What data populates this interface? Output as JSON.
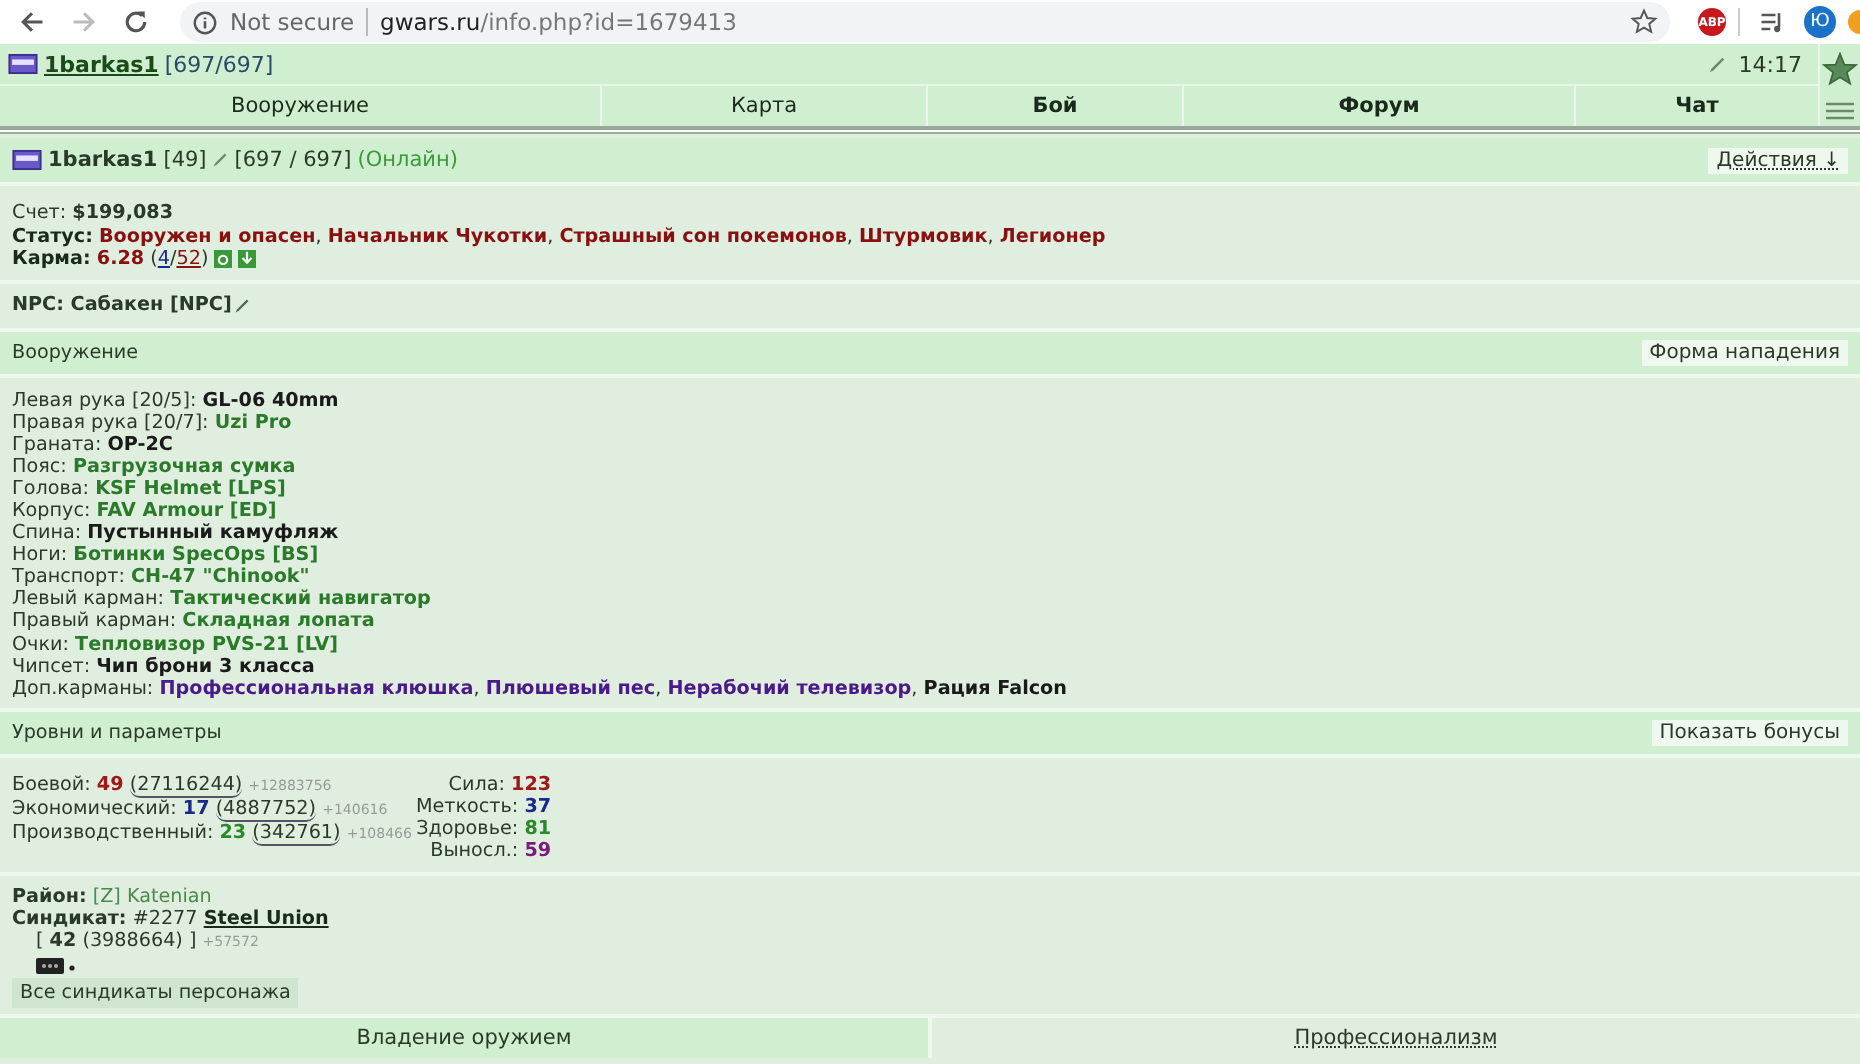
{
  "browser": {
    "security_label": "Not secure",
    "url_host": "gwars.ru",
    "url_path": "/info.php?id=1679413",
    "extension_badge": "ABP",
    "profile_initial": "Ю"
  },
  "header": {
    "nick": "1barkas1",
    "hp": "[697/697]",
    "time": "14:17"
  },
  "nav": [
    {
      "label": "Вооружение",
      "bold": false
    },
    {
      "label": "Карта",
      "bold": false
    },
    {
      "label": "Бой",
      "bold": true
    },
    {
      "label": "Форум",
      "bold": true
    },
    {
      "label": "Чат",
      "bold": true
    }
  ],
  "player": {
    "nick": "1barkas1",
    "level": "[49]",
    "hp": "[697 / 697]",
    "online": "(Онлайн)",
    "actions_button": "Действия ↓"
  },
  "account": {
    "label": "Счет:",
    "value": "$199,083"
  },
  "status": {
    "label": "Статус:",
    "separator": ", ",
    "items": [
      "Вооружен и опасен",
      "Начальник Чукотки",
      "Страшный сон покемонов",
      "Штурмовик",
      "Легионер"
    ]
  },
  "karma": {
    "label": "Карма:",
    "value": "6.28",
    "votes_open": "(",
    "votes_plus": "4",
    "votes_sep": "/",
    "votes_minus": "52",
    "votes_close": ")"
  },
  "npc": {
    "label": "NPC:",
    "value": "Сабакен [NPC]"
  },
  "equipment": {
    "title": "Вооружение",
    "button": "Форма нападения",
    "separator": ", ",
    "slots": [
      {
        "label": "Левая рука [20/5]:",
        "items": [
          {
            "name": "GL-06 40mm",
            "color": "#1a1a1a"
          }
        ]
      },
      {
        "label": "Правая рука [20/7]:",
        "items": [
          {
            "name": "Uzi Pro",
            "color": "#2a7a2a"
          }
        ]
      },
      {
        "label": "Граната:",
        "items": [
          {
            "name": "OP-2C",
            "color": "#1a1a1a"
          }
        ]
      },
      {
        "label": "Пояс:",
        "items": [
          {
            "name": "Разгрузочная сумка",
            "color": "#2a7a2a"
          }
        ]
      },
      {
        "label": "Голова:",
        "items": [
          {
            "name": "KSF Helmet [LPS]",
            "color": "#2a7a2a"
          }
        ]
      },
      {
        "label": "Корпус:",
        "items": [
          {
            "name": "FAV Armour [ED]",
            "color": "#2a7a2a"
          }
        ]
      },
      {
        "label": "Спина:",
        "items": [
          {
            "name": "Пустынный камуфляж",
            "color": "#1a1a1a"
          }
        ]
      },
      {
        "label": "Ноги:",
        "items": [
          {
            "name": "Ботинки SpecOps [BS]",
            "color": "#2a7a2a"
          }
        ]
      },
      {
        "label": "Транспорт:",
        "items": [
          {
            "name": "CH-47 \"Chinook\"",
            "color": "#2a7a2a"
          }
        ]
      },
      {
        "label": "Левый карман:",
        "items": [
          {
            "name": "Тактический навигатор",
            "color": "#2a7a2a"
          }
        ]
      },
      {
        "label": "Правый карман:",
        "items": [
          {
            "name": "Складная лопата",
            "color": "#2a7a2a"
          }
        ]
      },
      {
        "label": "Очки:",
        "items": [
          {
            "name": "Тепловизор PVS-21 [LV]",
            "color": "#2a7a2a"
          }
        ]
      },
      {
        "label": "Чипсет:",
        "items": [
          {
            "name": "Чип брони 3 класса",
            "color": "#1a1a1a"
          }
        ]
      },
      {
        "label": "Доп.карманы:",
        "items": [
          {
            "name": "Профессиональная клюшка",
            "color": "#4a1a8a"
          },
          {
            "name": "Плюшевый пес",
            "color": "#4a1a8a"
          },
          {
            "name": "Нерабочий телевизор",
            "color": "#4a1a8a"
          },
          {
            "name": "Рация Falcon",
            "color": "#1a1a1a"
          }
        ]
      }
    ]
  },
  "levels": {
    "title": "Уровни и параметры",
    "button": "Показать бонусы",
    "rows": [
      {
        "label": "Боевой:",
        "value": "49",
        "exp": "(27116244)",
        "gain": "+12883756",
        "color": "#a01818"
      },
      {
        "label": "Экономический:",
        "value": "17",
        "exp": "(4887752)",
        "gain": "+140616",
        "color": "#1a2a8a"
      },
      {
        "label": "Производственный:",
        "value": "23",
        "exp": "(342761)",
        "gain": "+108466",
        "color": "#2a8a2a"
      }
    ],
    "params": [
      {
        "label": "Сила:",
        "value": "123",
        "color": "#a01818"
      },
      {
        "label": "Меткость:",
        "value": "37",
        "color": "#1a2a8a"
      },
      {
        "label": "Здоровье:",
        "value": "81",
        "color": "#2a8a2a"
      },
      {
        "label": "Выносл.:",
        "value": "59",
        "color": "#7a1a7a"
      }
    ]
  },
  "district": {
    "label": "Район:",
    "value": "[Z] Katenian"
  },
  "syndicate": {
    "label": "Синдикат:",
    "number": "#2277",
    "name": "Steel Union",
    "level_line": "[ **42** (3988664) ]",
    "gain": "+57572",
    "button": "Все синдикаты персонажа"
  },
  "bottom_tabs": [
    {
      "label": "Владение оружием",
      "selected": true
    },
    {
      "label": "Профессионализм",
      "selected": false
    }
  ]
}
